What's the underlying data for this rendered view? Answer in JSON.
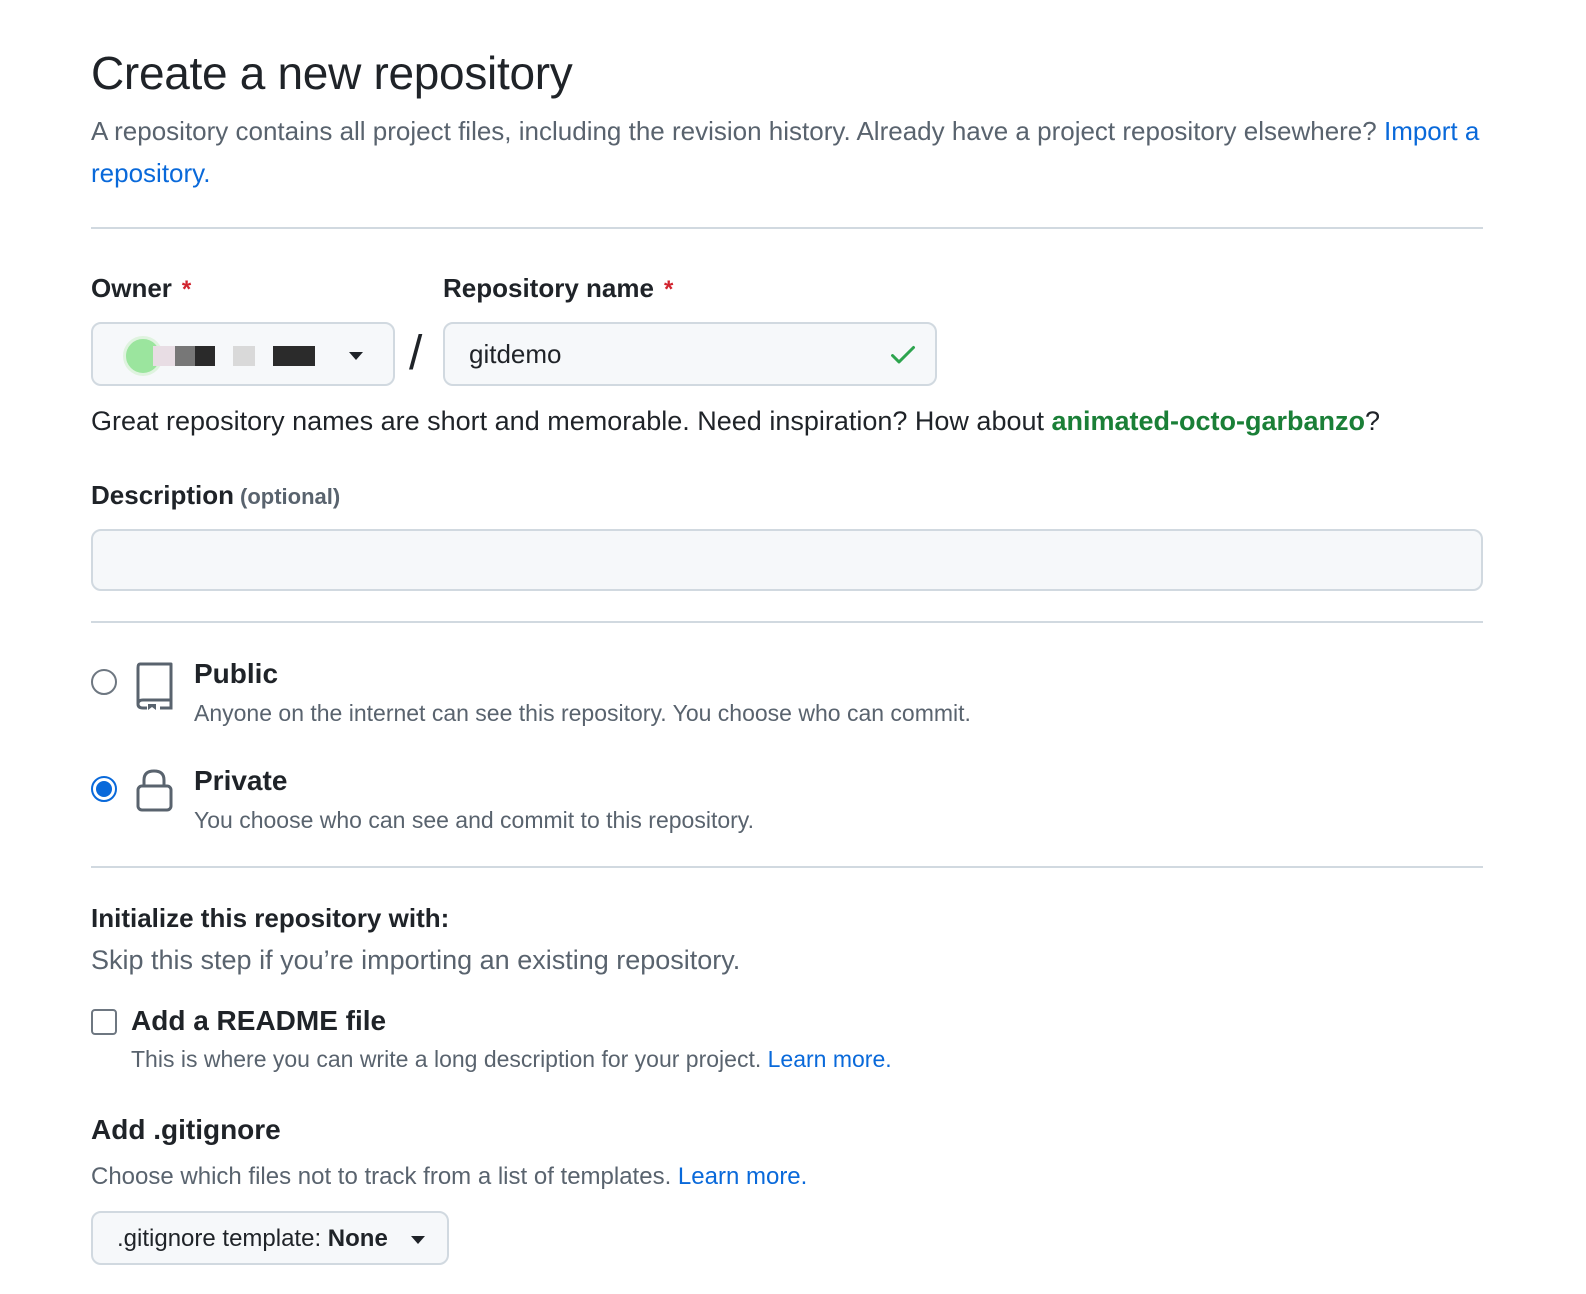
{
  "header": {
    "title": "Create a new repository",
    "subtitle_text": "A repository contains all project files, including the revision history. Already have a project repository elsewhere?",
    "import_link": "Import a repository."
  },
  "owner": {
    "label": "Owner",
    "required_mark": "*"
  },
  "repo_name": {
    "label": "Repository name",
    "required_mark": "*",
    "value": "gitdemo",
    "valid_icon": "check-icon",
    "slash": "/"
  },
  "name_hint": {
    "text": "Great repository names are short and memorable. Need inspiration? How about",
    "suggestion": "animated-octo-garbanzo",
    "suffix": "?"
  },
  "description": {
    "label": "Description",
    "optional": "(optional)",
    "value": ""
  },
  "visibility": {
    "options": [
      {
        "title": "Public",
        "desc": "Anyone on the internet can see this repository. You choose who can commit.",
        "icon": "repo-icon",
        "selected": false
      },
      {
        "title": "Private",
        "desc": "You choose who can see and commit to this repository.",
        "icon": "lock-icon",
        "selected": true
      }
    ]
  },
  "init": {
    "title": "Initialize this repository with:",
    "desc": "Skip this step if you’re importing an existing repository.",
    "readme": {
      "label": "Add a README file",
      "desc": "This is where you can write a long description for your project.",
      "link": "Learn more.",
      "checked": false
    }
  },
  "gitignore": {
    "title": "Add .gitignore",
    "desc": "Choose which files not to track from a list of templates.",
    "link": "Learn more.",
    "button_prefix": ".gitignore template:",
    "button_value": "None"
  },
  "colors": {
    "link": "#0969da",
    "success": "#1a7f37",
    "required": "#d1242f",
    "muted": "#59636e"
  }
}
